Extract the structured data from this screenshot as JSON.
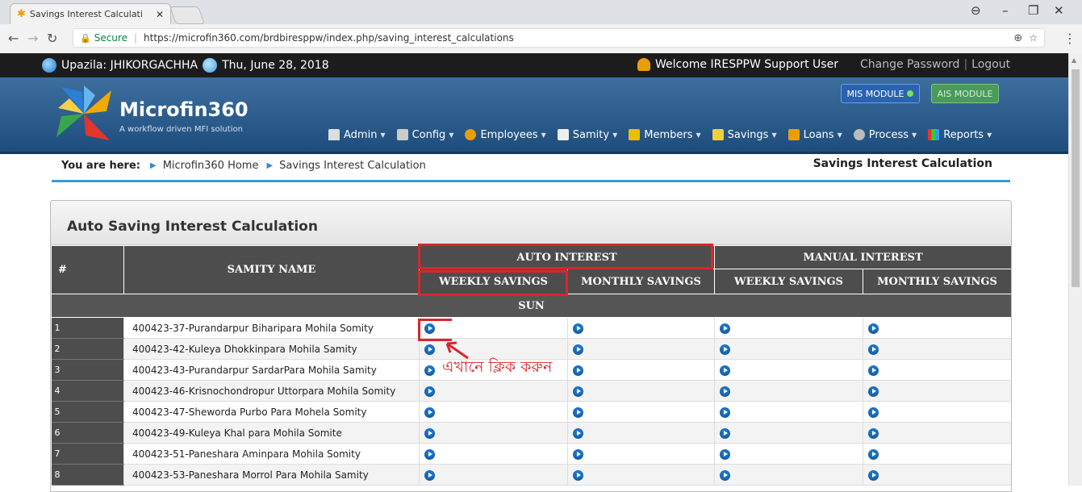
{
  "browser": {
    "tab_title": "Savings Interest Calculati",
    "secure_label": "Secure",
    "url": "https://microfin360.com/brdbiresppw/index.php/saving_interest_calculations"
  },
  "topbar": {
    "upazila": "Upazila: JHIKORGACHHA",
    "date": "Thu, June 28, 2018",
    "welcome": "Welcome IRESPPW Support User",
    "change_password": "Change Password",
    "logout": "Logout"
  },
  "header": {
    "brand": "Microfin360",
    "tagline": "A workflow driven MFI solution",
    "mis_module": "MIS MODULE",
    "ais_module": "AIS MODULE",
    "menu": [
      {
        "label": "Admin",
        "icon": "home-icon"
      },
      {
        "label": "Config",
        "icon": "tools-icon"
      },
      {
        "label": "Employees",
        "icon": "user-icon"
      },
      {
        "label": "Samity",
        "icon": "house-icon"
      },
      {
        "label": "Members",
        "icon": "members-icon"
      },
      {
        "label": "Savings",
        "icon": "savings-icon"
      },
      {
        "label": "Loans",
        "icon": "loans-icon"
      },
      {
        "label": "Process",
        "icon": "process-icon"
      },
      {
        "label": "Reports",
        "icon": "chart-icon"
      }
    ]
  },
  "breadcrumb": {
    "you_are_here": "You are here:",
    "home": "Microfin360 Home",
    "current": "Savings Interest Calculation",
    "page_title": "Savings Interest Calculation"
  },
  "panel": {
    "title": "Auto Saving Interest Calculation",
    "headers": {
      "num": "#",
      "samity_name": "SAMITY NAME",
      "auto_interest": "AUTO INTEREST",
      "manual_interest": "MANUAL INTEREST",
      "weekly": "WEEKLY SAVINGS",
      "monthly": "MONTHLY SAVINGS",
      "weekly2": "WEEKLY SAVINGS",
      "monthly2": "MONTHLY SAVINGS"
    },
    "group": "SUN",
    "rows": [
      {
        "idx": "1",
        "name": "400423-37-Purandarpur Biharipara Mohila Somity"
      },
      {
        "idx": "2",
        "name": "400423-42-Kuleya Dhokkinpara Mohila Samity"
      },
      {
        "idx": "3",
        "name": "400423-43-Purandarpur SardarPara Mohila Samity"
      },
      {
        "idx": "4",
        "name": "400423-46-Krisnochondropur Uttorpara Mohila Somity"
      },
      {
        "idx": "5",
        "name": "400423-47-Sheworda Purbo Para Mohela Somity"
      },
      {
        "idx": "6",
        "name": "400423-49-Kuleya Khal para Mohila Somite"
      },
      {
        "idx": "7",
        "name": "400423-51-Paneshara Aminpara Mohila Somity"
      },
      {
        "idx": "8",
        "name": "400423-53-Paneshara Morrol Para Mohila Samity"
      }
    ]
  },
  "annotation": {
    "text": "এখানে ক্লিক করুন"
  },
  "colors": {
    "header_blue": "#2a5d8f",
    "accent_blue": "#3a9ad9",
    "annotation_red": "#d9262c",
    "table_header": "#4d4d4d"
  }
}
